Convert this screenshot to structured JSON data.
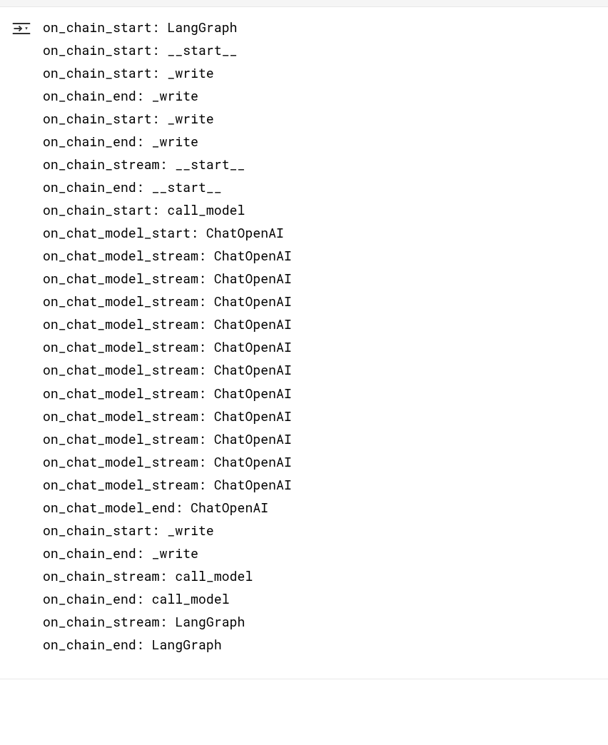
{
  "output": {
    "lines": [
      "on_chain_start: LangGraph",
      "on_chain_start: __start__",
      "on_chain_start: _write",
      "on_chain_end: _write",
      "on_chain_start: _write",
      "on_chain_end: _write",
      "on_chain_stream: __start__",
      "on_chain_end: __start__",
      "on_chain_start: call_model",
      "on_chat_model_start: ChatOpenAI",
      "on_chat_model_stream: ChatOpenAI",
      "on_chat_model_stream: ChatOpenAI",
      "on_chat_model_stream: ChatOpenAI",
      "on_chat_model_stream: ChatOpenAI",
      "on_chat_model_stream: ChatOpenAI",
      "on_chat_model_stream: ChatOpenAI",
      "on_chat_model_stream: ChatOpenAI",
      "on_chat_model_stream: ChatOpenAI",
      "on_chat_model_stream: ChatOpenAI",
      "on_chat_model_stream: ChatOpenAI",
      "on_chat_model_stream: ChatOpenAI",
      "on_chat_model_end: ChatOpenAI",
      "on_chain_start: _write",
      "on_chain_end: _write",
      "on_chain_stream: call_model",
      "on_chain_end: call_model",
      "on_chain_stream: LangGraph",
      "on_chain_end: LangGraph"
    ]
  }
}
